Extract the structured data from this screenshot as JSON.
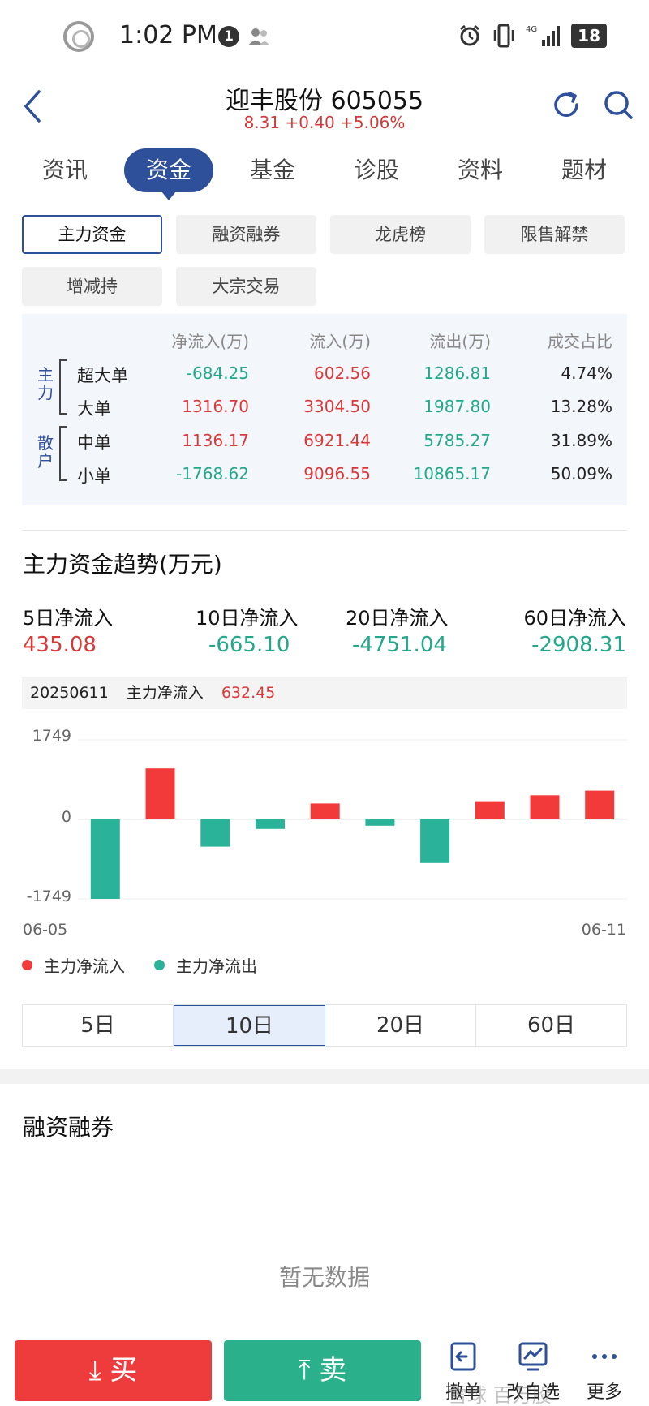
{
  "status_bar": {
    "time": "1:02 PM",
    "badge": "1",
    "battery": "18",
    "network": "4G"
  },
  "header": {
    "title": "迎丰股份 605055",
    "quote": "8.31 +0.40 +5.06%"
  },
  "main_tabs": [
    "资讯",
    "资金",
    "基金",
    "诊股",
    "资料",
    "题材"
  ],
  "sub_tabs": [
    "主力资金",
    "融资融券",
    "龙虎榜",
    "限售解禁",
    "增减持",
    "大宗交易"
  ],
  "flow_table": {
    "headers": [
      "净流入(万)",
      "流入(万)",
      "流出(万)",
      "成交占比"
    ],
    "groups": [
      "主力",
      "散户"
    ],
    "rows": [
      {
        "name": "超大单",
        "net": "-684.25",
        "inflow": "602.56",
        "outflow": "1286.81",
        "ratio": "4.74%"
      },
      {
        "name": "大单",
        "net": "1316.70",
        "inflow": "3304.50",
        "outflow": "1987.80",
        "ratio": "13.28%"
      },
      {
        "name": "中单",
        "net": "1136.17",
        "inflow": "6921.44",
        "outflow": "5785.27",
        "ratio": "31.89%"
      },
      {
        "name": "小单",
        "net": "-1768.62",
        "inflow": "9096.55",
        "outflow": "10865.17",
        "ratio": "50.09%"
      }
    ]
  },
  "trend": {
    "title": "主力资金趋势(万元)",
    "stats": [
      {
        "label": "5日净流入",
        "value": "435.08"
      },
      {
        "label": "10日净流入",
        "value": "-665.10"
      },
      {
        "label": "20日净流入",
        "value": "-4751.04"
      },
      {
        "label": "60日净流入",
        "value": "-2908.31"
      }
    ],
    "info": {
      "date": "20250611",
      "label": "主力净流入",
      "value": "632.45"
    }
  },
  "chart_data": {
    "type": "bar",
    "x_start": "06-05",
    "x_end": "06-11",
    "y_ticks": [
      "1749",
      "0",
      "-1749"
    ],
    "ylim": [
      -1749,
      1749
    ],
    "values": [
      -1749,
      1120,
      -600,
      -210,
      350,
      -140,
      -960,
      400,
      530,
      632.45
    ],
    "legend": [
      "主力净流入",
      "主力净流出"
    ],
    "colors": {
      "inflow": "#f23a3a",
      "outflow": "#2ab398"
    }
  },
  "periods": [
    "5日",
    "10日",
    "20日",
    "60日"
  ],
  "margin_section": {
    "title": "融资融券",
    "empty": "暂无数据"
  },
  "bottom_bar": {
    "buy": "买",
    "sell": "卖",
    "tools": [
      "撤单",
      "改自选",
      "更多"
    ],
    "watermark": "雪球 百万股"
  }
}
